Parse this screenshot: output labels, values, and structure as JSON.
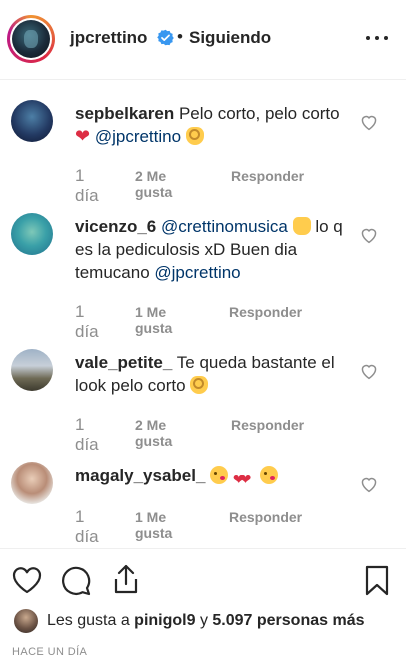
{
  "header": {
    "username": "jpcrettino",
    "separator": "•",
    "follow_status": "Siguiendo"
  },
  "comments": [
    {
      "username": "sepbelkaren",
      "text_parts": [
        "Pelo corto, pelo corto ",
        "@jpcrettino"
      ],
      "time": "1 día",
      "likes": "2 Me gusta",
      "reply": "Responder"
    },
    {
      "username": "vicenzo_6",
      "text_parts": [
        "@crettinomusica",
        " lo q es la pediculosis xD Buen dia temucano ",
        "@jpcrettino"
      ],
      "time": "1 día",
      "likes": "1 Me gusta",
      "reply": "Responder"
    },
    {
      "username": "vale_petite_",
      "text_parts": [
        "Te queda bastante el look pelo corto "
      ],
      "time": "1 día",
      "likes": "2 Me gusta",
      "reply": "Responder"
    },
    {
      "username": "magaly_ysabel_",
      "text_parts": [],
      "time": "1 día",
      "likes": "1 Me gusta",
      "reply": "Responder"
    }
  ],
  "footer": {
    "liked_prefix": "Les gusta a ",
    "liked_user": "pinigol9",
    "liked_middle": " y ",
    "liked_count": "5.097 personas más",
    "posted_ago": "HACE UN DÍA"
  },
  "colors": {
    "text": "#262626",
    "muted": "#8e8e8e",
    "mention": "#003569",
    "verified": "#3897f0",
    "heart_red": "#dd2e44"
  },
  "icons": {
    "header": [
      "verified-badge-icon",
      "more-options-icon"
    ],
    "comment": [
      "like-heart-icon"
    ],
    "actions": [
      "like-icon",
      "comment-icon",
      "share-icon",
      "save-bookmark-icon"
    ]
  }
}
